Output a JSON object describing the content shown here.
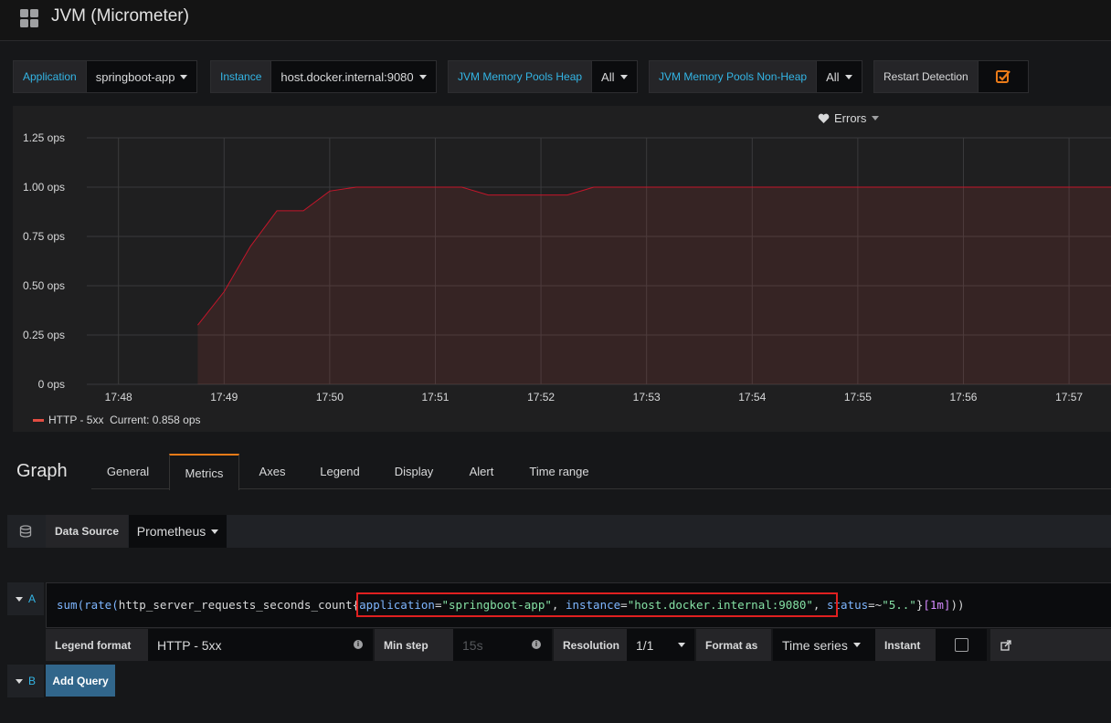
{
  "dashboard": {
    "title": "JVM (Micrometer)"
  },
  "variables": [
    {
      "label": "Application",
      "value": "springboot-app"
    },
    {
      "label": "Instance",
      "value": "host.docker.internal:9080"
    },
    {
      "label": "JVM Memory Pools Heap",
      "value": "All"
    },
    {
      "label": "JVM Memory Pools Non-Heap",
      "value": "All"
    },
    {
      "label": "Restart Detection",
      "checked": true
    }
  ],
  "panel": {
    "title": "Errors",
    "legend": {
      "name": "HTTP - 5xx",
      "current": "Current: 0.858 ops",
      "color": "#e24d42"
    }
  },
  "chart_data": {
    "type": "area",
    "title": "Errors",
    "ylim": [
      0,
      1.25
    ],
    "yticks": [
      "0 ops",
      "0.25 ops",
      "0.50 ops",
      "0.75 ops",
      "1.00 ops",
      "1.25 ops"
    ],
    "xticks": [
      "17:48",
      "17:49",
      "17:50",
      "17:51",
      "17:52",
      "17:53",
      "17:54",
      "17:55",
      "17:56",
      "17:57"
    ],
    "x_minutes": [
      48.75,
      49.0,
      49.25,
      49.5,
      49.75,
      50.0,
      50.25,
      50.5,
      50.75,
      51.0,
      51.25,
      51.5,
      51.75,
      52.0,
      52.25,
      52.5,
      53.0,
      54.0,
      55.0,
      56.0,
      57.0,
      57.7
    ],
    "series": [
      {
        "name": "HTTP - 5xx",
        "values": [
          0.3,
          0.47,
          0.7,
          0.88,
          0.88,
          0.98,
          1.0,
          1.0,
          1.0,
          1.0,
          1.0,
          0.96,
          0.96,
          0.96,
          0.96,
          1.0,
          1.0,
          1.0,
          1.0,
          1.0,
          1.0,
          1.0
        ]
      }
    ]
  },
  "editor": {
    "title": "Graph",
    "tabs": [
      "General",
      "Metrics",
      "Axes",
      "Legend",
      "Display",
      "Alert",
      "Time range"
    ],
    "active_tab": "Metrics",
    "data_source_label": "Data Source",
    "data_source_value": "Prometheus",
    "query_a": {
      "ref": "A",
      "expr_prefix": "sum(rate(",
      "metric": "http_server_requests_seconds_count",
      "l1_key": "application",
      "l1_val": "\"springboot-app\"",
      "l2_key": "instance",
      "l2_val": "\"host.docker.internal:9080\"",
      "l3_key": "status",
      "l3_op": "=~",
      "l3_val": "\"5..\"",
      "range": "[1m]",
      "expr_suffix": "))"
    },
    "options": {
      "legend_format_label": "Legend format",
      "legend_format_value": "HTTP - 5xx",
      "min_step_label": "Min step",
      "min_step_placeholder": "15s",
      "resolution_label": "Resolution",
      "resolution_value": "1/1",
      "format_as_label": "Format as",
      "format_as_value": "Time series",
      "instant_label": "Instant"
    },
    "query_b": {
      "ref": "B"
    },
    "add_query_label": "Add Query"
  }
}
